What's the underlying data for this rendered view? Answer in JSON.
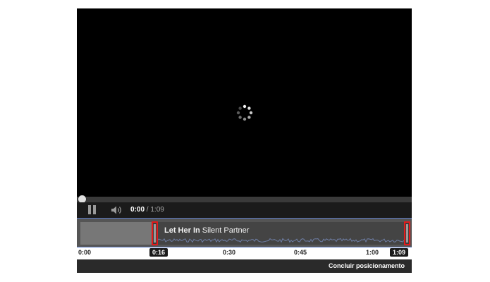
{
  "player": {
    "time_current": "0:00",
    "time_separator": " / ",
    "time_total": "1:09",
    "progress_fraction": 0
  },
  "audio_track": {
    "title_bold": "Let Her In",
    "title_rest": " Silent Partner"
  },
  "timeline": {
    "ticks": [
      "0:00",
      "0:16",
      "0:30",
      "0:45",
      "1:00",
      "1:09"
    ]
  },
  "footer": {
    "done_label": "Concluir posicionamento"
  },
  "colors": {
    "handle_border": "#e11b1b",
    "track_border": "#5b79c6"
  },
  "icons": {
    "spinner": "loading-spinner-icon",
    "pause": "pause-icon",
    "volume": "volume-icon"
  }
}
